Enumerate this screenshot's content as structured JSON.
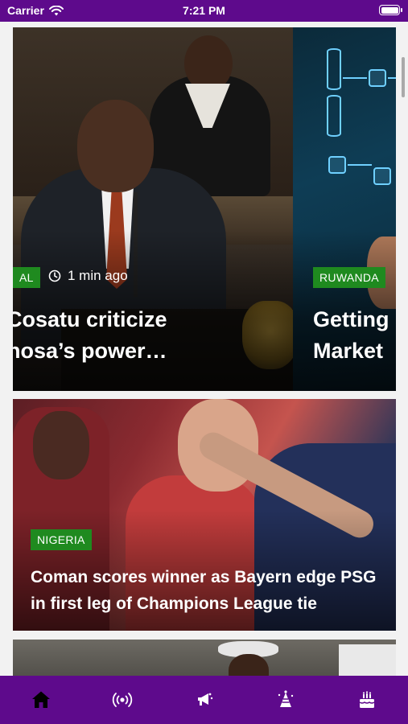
{
  "status_bar": {
    "carrier": "Carrier",
    "time": "7:21 PM"
  },
  "carousel": {
    "slides": [
      {
        "badge": "AL",
        "time_ago": "1 min ago",
        "title_line1": "Cosatu criticize",
        "title_line2": "hosa’s power…"
      },
      {
        "badge": "RUWANDA",
        "title_line1": "Getting",
        "title_line2": "Market"
      }
    ]
  },
  "feed": {
    "cards": [
      {
        "badge": "NIGERIA",
        "title": "Coman scores winner as Bayern edge PSG in first leg of Champions League tie"
      }
    ]
  },
  "tab_bar": {
    "tabs": [
      {
        "icon": "home-icon",
        "active": true
      },
      {
        "icon": "broadcast-icon",
        "active": false
      },
      {
        "icon": "megaphone-icon",
        "active": false
      },
      {
        "icon": "party-icon",
        "active": false
      },
      {
        "icon": "cake-icon",
        "active": false
      }
    ]
  },
  "colors": {
    "brand_purple": "#5e0a8c",
    "badge_green": "#1f8a1f"
  }
}
